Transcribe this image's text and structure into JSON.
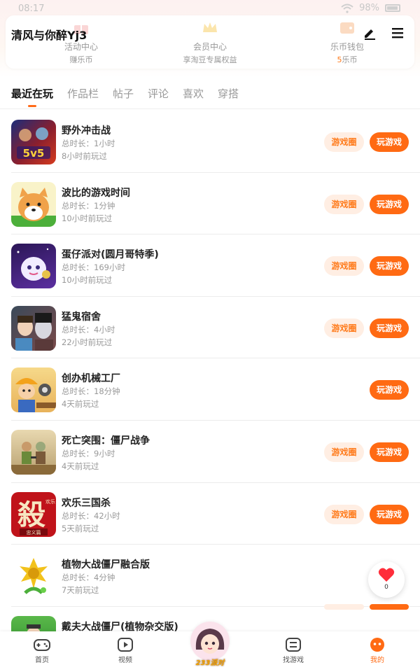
{
  "status_bar": {
    "time": "08:17",
    "battery": "98%"
  },
  "header": {
    "username": "清风与你醉Yj3"
  },
  "shortcuts": [
    {
      "label": "活动中心",
      "sub": "赚乐币",
      "num": ""
    },
    {
      "label": "会员中心",
      "sub": "享淘豆专属权益",
      "num": ""
    },
    {
      "label": "乐币钱包",
      "sub": "乐币",
      "num": "5"
    }
  ],
  "tabs": [
    "最近在玩",
    "作品栏",
    "帖子",
    "评论",
    "喜欢",
    "穿搭"
  ],
  "active_tab": "最近在玩",
  "games": [
    {
      "name": "野外冲击战",
      "duration": "总时长：1小时",
      "last_played": "8小时前玩过",
      "circle_btn": "游戏圈",
      "play_btn": "玩游戏"
    },
    {
      "name": "波比的游戏时间",
      "duration": "总时长：1分钟",
      "last_played": "10小时前玩过",
      "circle_btn": "游戏圈",
      "play_btn": "玩游戏"
    },
    {
      "name": "蛋仔派对(圆月哥特季)",
      "duration": "总时长：169小时",
      "last_played": "10小时前玩过",
      "circle_btn": "游戏圈",
      "play_btn": "玩游戏"
    },
    {
      "name": "猛鬼宿舍",
      "duration": "总时长：4小时",
      "last_played": "22小时前玩过",
      "circle_btn": "游戏圈",
      "play_btn": "玩游戏"
    },
    {
      "name": "创办机械工厂",
      "duration": "总时长：18分钟",
      "last_played": "4天前玩过",
      "circle_btn": "",
      "play_btn": "玩游戏"
    },
    {
      "name": "死亡突围：僵尸战争",
      "duration": "总时长：9小时",
      "last_played": "4天前玩过",
      "circle_btn": "游戏圈",
      "play_btn": "玩游戏"
    },
    {
      "name": "欢乐三国杀",
      "duration": "总时长：42小时",
      "last_played": "5天前玩过",
      "circle_btn": "游戏圈",
      "play_btn": "玩游戏"
    },
    {
      "name": "植物大战僵尸融合版",
      "duration": "总时长：4分钟",
      "last_played": "7天前玩过",
      "circle_btn": "",
      "play_btn": ""
    },
    {
      "name": "戴夫大战僵尸(植物杂交版)",
      "duration": "",
      "last_played": "",
      "circle_btn": "",
      "play_btn": ""
    }
  ],
  "game_icon_text": {
    "sanguosha_big": "殺",
    "sanguosha_small_1": "欢乐",
    "sanguosha_small_2": "忠义篇",
    "battle_badge": "5v5"
  },
  "float_heart": {
    "count": "0"
  },
  "bottom_nav": [
    {
      "label": "首页"
    },
    {
      "label": "视频"
    },
    {
      "label": "233派对"
    },
    {
      "label": "找游戏"
    },
    {
      "label": "我的"
    }
  ],
  "colors": {
    "accent": "#ff6a13",
    "accent_light": "#ffeee3"
  }
}
